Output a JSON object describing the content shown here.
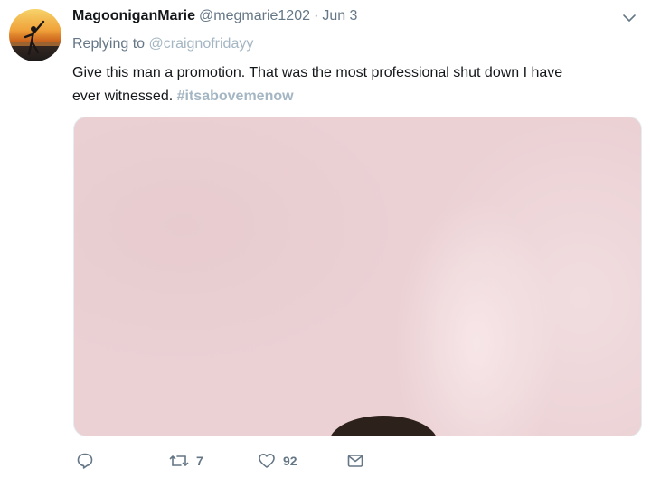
{
  "tweet": {
    "display_name": "MagooniganMarie",
    "handle": "@megmarie1202",
    "separator": "·",
    "date": "Jun 3",
    "replying_prefix": "Replying to",
    "replying_handle": "@craignofridayy",
    "text_line1": "Give this man a promotion. That was the most professional shut down I have",
    "text_line2": "ever witnessed.",
    "hashtag": "#itsabovemenow"
  },
  "actions": {
    "reply_count": "",
    "retweet_count": "7",
    "like_count": "92"
  },
  "colors": {
    "text": "#14171a",
    "muted": "#657786",
    "link_faded": "#a4b6c3",
    "media_bg": "#ebd1d4"
  }
}
